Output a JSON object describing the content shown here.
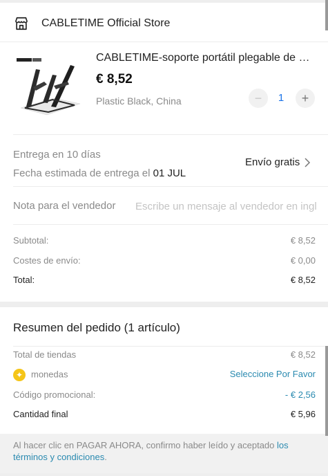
{
  "store": {
    "name": "CABLETIME Official Store",
    "icon": "store-icon"
  },
  "product": {
    "title": "CABLETIME-soporte portátil plegable de aluminio",
    "price": "€ 8,52",
    "variant": "Plastic Black, China",
    "quantity": "1",
    "minus_label": "−",
    "plus_label": "+",
    "thumb_badge_left": "",
    "thumb_badge_right": ""
  },
  "delivery": {
    "estimate": "Entrega en 10 días",
    "eta_prefix": "Fecha estimada de entrega el ",
    "eta_date": "01 JUL",
    "shipping": "Envío gratis"
  },
  "note": {
    "label": "Nota para el vendedor",
    "placeholder": "Escribe un mensaje al vendedor en inglés",
    "value": ""
  },
  "totals": {
    "subtotal_label": "Subtotal:",
    "subtotal_value": "€ 8,52",
    "shipping_label": "Costes de envío:",
    "shipping_value": "€ 0,00",
    "total_label": "Total:",
    "total_value": "€ 8,52"
  },
  "summary": {
    "title": "Resumen del pedido (1 artículo)",
    "stores_label": "Total de tiendas",
    "stores_value": "€ 8,52",
    "coins_label": "monedas",
    "coins_action": "Seleccione Por Favor",
    "promo_label": "Código promocional:",
    "promo_value": "- € 2,56",
    "final_label": "Cantidad final",
    "final_value": "€ 5,96"
  },
  "disclaimer": {
    "text": "Al hacer clic en PAGAR AHORA, confirmo haber leído y aceptado ",
    "link": "los términos y condiciones",
    "suffix": "."
  },
  "colors": {
    "link": "#2a8ab0",
    "quantity": "#1a73e8",
    "coin": "#f5c518"
  }
}
